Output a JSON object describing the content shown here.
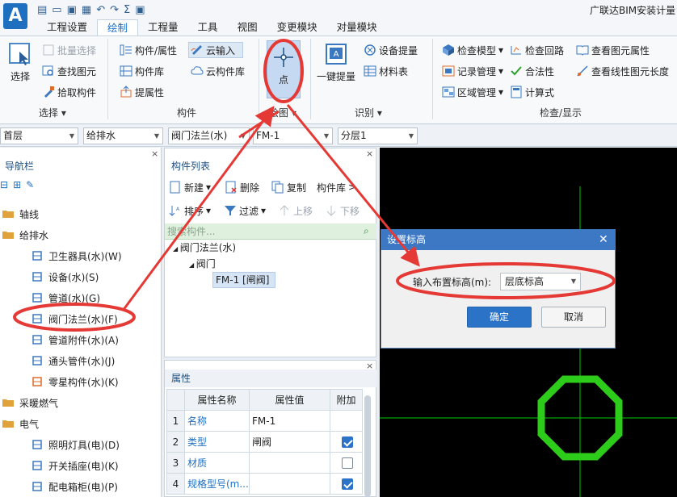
{
  "app": {
    "logo": "A",
    "title": "广联达BIM安装计量"
  },
  "quick_access": [
    "page-icon",
    "open-icon",
    "save-icon",
    "export-icon",
    "undo-icon",
    "redo-icon",
    "sum-icon",
    "save2-icon"
  ],
  "menu": {
    "tabs": [
      "工程设置",
      "绘制",
      "工程量",
      "工具",
      "视图",
      "变更模块",
      "对量模块"
    ],
    "active": "绘制"
  },
  "ribbon": {
    "select_group": {
      "label": "选择",
      "big_button": "选择",
      "items": [
        "批量选择",
        "查找图元",
        "拾取构件"
      ]
    },
    "component_group": {
      "label": "构件",
      "items": [
        "构件/属性",
        "构件库",
        "提属性",
        "云输入",
        "云构件库"
      ]
    },
    "draw_group": {
      "label": "绘图",
      "big_button": "点"
    },
    "identify_group": {
      "label": "识别",
      "big_button": "一键提量",
      "items": [
        "设备提量",
        "材料表"
      ]
    },
    "check_group": {
      "label": "检查/显示",
      "items": [
        "检查模型",
        "记录管理",
        "区域管理",
        "检查回路",
        "合法性",
        "计算式",
        "查看图元属性",
        "查看线性图元长度"
      ]
    }
  },
  "selectors": [
    "首层",
    "给排水",
    "阀门法兰(水)",
    "FM-1",
    "分层1"
  ],
  "nav": {
    "title": "导航栏",
    "items": [
      {
        "label": "轴线",
        "level": 0,
        "icon": "folder-icon"
      },
      {
        "label": "给排水",
        "level": 0,
        "icon": "folder-icon"
      },
      {
        "label": "卫生器具(水)(W)",
        "level": 1,
        "icon": "faucet-icon"
      },
      {
        "label": "设备(水)(S)",
        "level": 1,
        "icon": "equipment-icon"
      },
      {
        "label": "管道(水)(G)",
        "level": 1,
        "icon": "pipe-icon"
      },
      {
        "label": "阀门法兰(水)(F)",
        "level": 1,
        "icon": "valve-icon"
      },
      {
        "label": "管道附件(水)(A)",
        "level": 1,
        "icon": "pipe-fitting-icon"
      },
      {
        "label": "通头管件(水)(J)",
        "level": 1,
        "icon": "tee-icon"
      },
      {
        "label": "零星构件(水)(K)",
        "level": 1,
        "icon": "misc-part-icon"
      },
      {
        "label": "采暖燃气",
        "level": 0,
        "icon": "folder-icon"
      },
      {
        "label": "电气",
        "level": 0,
        "icon": "folder-icon"
      },
      {
        "label": "照明灯具(电)(D)",
        "level": 1,
        "icon": "lamp-icon"
      },
      {
        "label": "开关插座(电)(K)",
        "level": 1,
        "icon": "switch-icon"
      },
      {
        "label": "配电箱柜(电)(P)",
        "level": 1,
        "icon": "distribution-box-icon"
      }
    ]
  },
  "component_list": {
    "title": "构件列表",
    "toolbar": [
      "新建",
      "删除",
      "复制",
      "构件库",
      "排序",
      "过滤",
      "上移",
      "下移"
    ],
    "search_placeholder": "搜索构件...",
    "tree": [
      "阀门法兰(水)",
      "阀门",
      "FM-1 [闸阀]"
    ]
  },
  "properties": {
    "title": "属性",
    "columns": [
      "属性名称",
      "属性值",
      "附加"
    ],
    "rows": [
      {
        "num": "1",
        "name": "名称",
        "value": "FM-1",
        "checked": null
      },
      {
        "num": "2",
        "name": "类型",
        "value": "闸阀",
        "checked": true
      },
      {
        "num": "3",
        "name": "材质",
        "value": "",
        "checked": false
      },
      {
        "num": "4",
        "name": "规格型号(m...",
        "value": "",
        "checked": true
      }
    ]
  },
  "dialog": {
    "title": "设置标高",
    "field_label": "输入布置标高(m):",
    "value": "层底标高",
    "ok": "确定",
    "cancel": "取消"
  },
  "colors": {
    "accent": "#2a73c7",
    "annotation": "#e53935",
    "canvas_axis": "#00c800",
    "octagon": "#2ecc1a"
  }
}
